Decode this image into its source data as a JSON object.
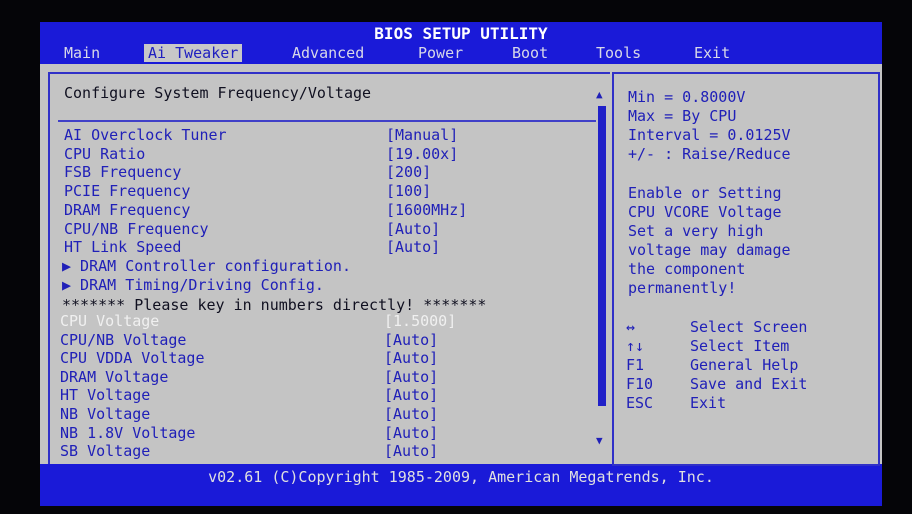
{
  "title": "BIOS SETUP UTILITY",
  "menu": [
    "Main",
    "Ai Tweaker",
    "Advanced",
    "Power",
    "Boot",
    "Tools",
    "Exit"
  ],
  "section_title": "Configure System Frequency/Voltage",
  "settings": [
    {
      "label": "AI Overclock Tuner",
      "value": "[Manual]"
    },
    {
      "label": "CPU Ratio",
      "value": "[19.00x]"
    },
    {
      "label": "FSB Frequency",
      "value": "[200]"
    },
    {
      "label": "PCIE Frequency",
      "value": "[100]"
    },
    {
      "label": "DRAM Frequency",
      "value": "[1600MHz]"
    },
    {
      "label": "CPU/NB Frequency",
      "value": "[Auto]"
    },
    {
      "label": "HT Link Speed",
      "value": "[Auto]"
    }
  ],
  "submenus": [
    "▶ DRAM Controller configuration.",
    "▶ DRAM Timing/Driving Config."
  ],
  "note": "******* Please key in numbers directly! *******",
  "voltages": [
    {
      "label": "CPU Voltage",
      "value": "[1.5000]"
    },
    {
      "label": "CPU/NB Voltage",
      "value": "[Auto]"
    },
    {
      "label": "CPU VDDA Voltage",
      "value": "[Auto]"
    },
    {
      "label": "DRAM Voltage",
      "value": "[Auto]"
    },
    {
      "label": "HT Voltage",
      "value": "[Auto]"
    },
    {
      "label": "NB Voltage",
      "value": "[Auto]"
    },
    {
      "label": "NB 1.8V Voltage",
      "value": "[Auto]"
    },
    {
      "label": "SB Voltage",
      "value": "[Auto]"
    }
  ],
  "help": {
    "range": [
      "Min = 0.8000V",
      "Max = By CPU",
      "Interval = 0.0125V",
      "+/- : Raise/Reduce"
    ],
    "description": [
      "Enable or Setting",
      "CPU VCORE Voltage",
      "Set a very high",
      "voltage may damage",
      "the component",
      "permanently!"
    ]
  },
  "keys": [
    {
      "key": "↔",
      "action": "Select Screen"
    },
    {
      "key": "↑↓",
      "action": "Select Item"
    },
    {
      "key": "F1",
      "action": "General Help"
    },
    {
      "key": "F10",
      "action": "Save and Exit"
    },
    {
      "key": "ESC",
      "action": "Exit"
    }
  ],
  "footer": "v02.61 (C)Copyright 1985-2009, American Megatrends, Inc."
}
